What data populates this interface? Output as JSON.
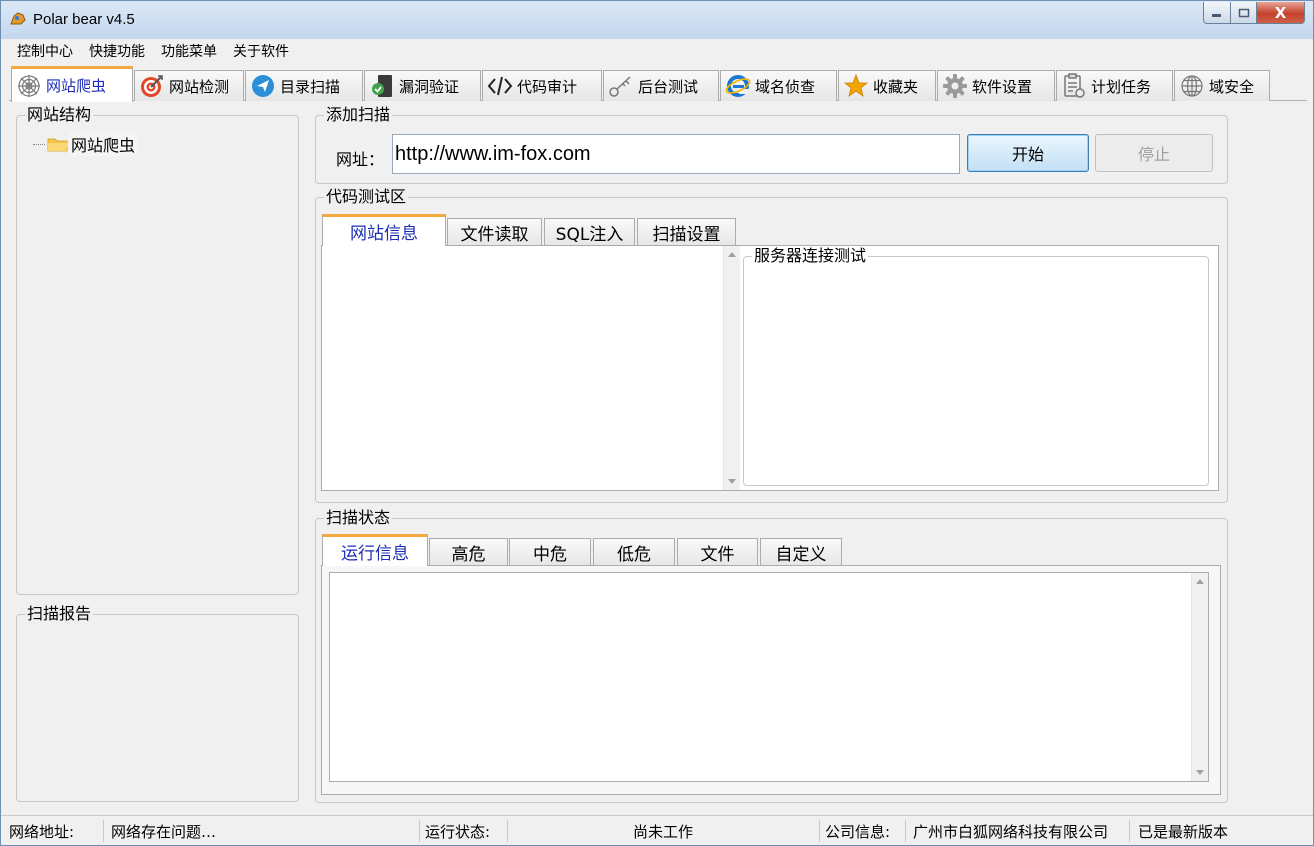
{
  "window": {
    "title": "Polar bear v4.5",
    "close_glyph": "X"
  },
  "menu": [
    "控制中心",
    "快捷功能",
    "功能菜单",
    "关于软件"
  ],
  "main_tabs": [
    {
      "label": "网站爬虫",
      "icon": "spider-web-icon"
    },
    {
      "label": "网站检测",
      "icon": "target-icon"
    },
    {
      "label": "目录扫描",
      "icon": "paper-plane-icon"
    },
    {
      "label": "漏洞验证",
      "icon": "shield-check-icon"
    },
    {
      "label": "代码审计",
      "icon": "code-brackets-icon"
    },
    {
      "label": "后台测试",
      "icon": "key-icon"
    },
    {
      "label": "域名侦查",
      "icon": "internet-explorer-icon"
    },
    {
      "label": "收藏夹",
      "icon": "star-icon"
    },
    {
      "label": "软件设置",
      "icon": "gear-icon"
    },
    {
      "label": "计划任务",
      "icon": "clipboard-icon"
    },
    {
      "label": "域安全",
      "icon": "globe-icon"
    }
  ],
  "left": {
    "structure_title": "网站结构",
    "tree_root": "网站爬虫",
    "report_title": "扫描报告"
  },
  "add_scan": {
    "title": "添加扫描",
    "url_label": "网址：",
    "url_value": "http://www.im-fox.com",
    "start_label": "开始",
    "stop_label": "停止"
  },
  "code_test": {
    "title": "代码测试区",
    "tabs": [
      "网站信息",
      "文件读取",
      "SQL注入",
      "扫描设置"
    ],
    "server_test_title": "服务器连接测试"
  },
  "scan_status": {
    "title": "扫描状态",
    "tabs": [
      "运行信息",
      "高危",
      "中危",
      "低危",
      "文件",
      "自定义"
    ]
  },
  "status_bar": {
    "net_label": "网络地址:",
    "net_value": "网络存在问题…",
    "run_label": "运行状态:",
    "run_value": "尚未工作",
    "company_label": "公司信息:",
    "company_value": "广州市白狐网络科技有限公司",
    "version_value": "已是最新版本"
  },
  "colors": {
    "accent_tab": "#f4a93e",
    "active_text": "#1d2db5",
    "title_bar": "#c4d7ee"
  }
}
